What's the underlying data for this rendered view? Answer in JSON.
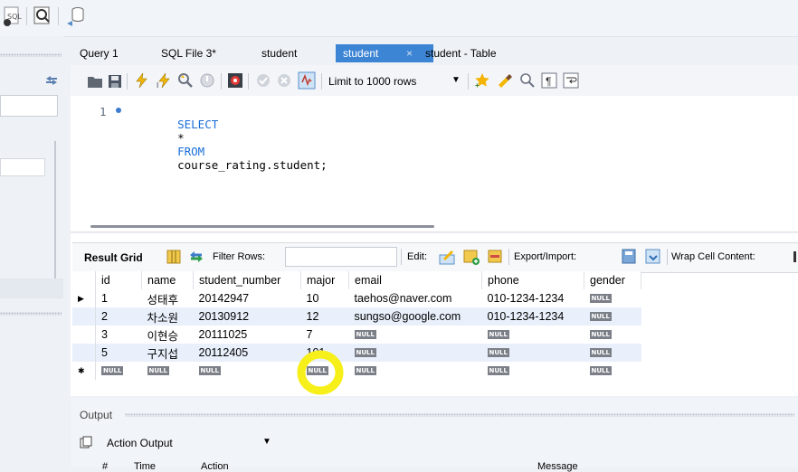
{
  "tabs": [
    "Query 1",
    "SQL File 3*",
    "student",
    "student",
    "student - Table"
  ],
  "active_tab_close": "×",
  "limit": {
    "value": "Limit to 1000 rows"
  },
  "editor": {
    "line_number": "1",
    "keyword_select": "SELECT",
    "star": "*",
    "keyword_from": "FROM",
    "rest": "course_rating.student;"
  },
  "result_toolbar": {
    "result_grid": "Result Grid",
    "filter_rows": "Filter Rows:",
    "edit": "Edit:",
    "export_import": "Export/Import:",
    "wrap_cell": "Wrap Cell Content:"
  },
  "grid": {
    "columns": [
      "id",
      "name",
      "student_number",
      "major",
      "email",
      "phone",
      "gender"
    ],
    "null_label": "NULL",
    "rows": [
      {
        "id": "1",
        "name": "성태후",
        "student_number": "20142947",
        "major": "10",
        "email": "taehos@naver.com",
        "phone": "010-1234-1234",
        "gender": "NULL"
      },
      {
        "id": "2",
        "name": "차소원",
        "student_number": "20130912",
        "major": "12",
        "email": "sungso@google.com",
        "phone": "010-1234-1234",
        "gender": "NULL"
      },
      {
        "id": "3",
        "name": "이현승",
        "student_number": "20111025",
        "major": "7",
        "email": "NULL",
        "phone": "NULL",
        "gender": "NULL"
      },
      {
        "id": "5",
        "name": "구지섭",
        "student_number": "20112405",
        "major": "101",
        "email": "NULL",
        "phone": "NULL",
        "gender": "NULL"
      },
      {
        "id": "NULL",
        "name": "NULL",
        "student_number": "NULL",
        "major": "NULL",
        "email": "NULL",
        "phone": "NULL",
        "gender": "NULL"
      }
    ],
    "row_markers": [
      "▶",
      "",
      "",
      "",
      "✱"
    ]
  },
  "output": {
    "title": "Output",
    "selector": "Action Output",
    "columns": [
      "#",
      "Time",
      "Action",
      "Message"
    ]
  },
  "colors": {
    "active_tab": "#3c84d4",
    "highlight": "#f6ef1a",
    "row_alt": "#e9f0fb",
    "null_badge": "#7b7f87"
  }
}
